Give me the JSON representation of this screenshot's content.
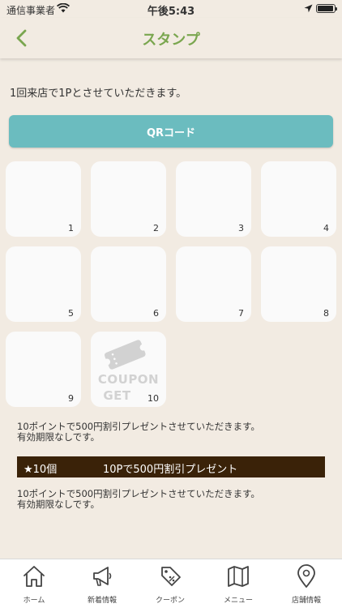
{
  "status_bar": {
    "carrier": "通信事業者",
    "time": "午後5:43"
  },
  "nav": {
    "title": "スタンプ"
  },
  "intro_text": "1回来店で1Pとさせていただきます。",
  "qr_button_label": "QRコード",
  "stamp_cells": [
    {
      "number": "1"
    },
    {
      "number": "2"
    },
    {
      "number": "3"
    },
    {
      "number": "4"
    },
    {
      "number": "5"
    },
    {
      "number": "6"
    },
    {
      "number": "7"
    },
    {
      "number": "8"
    },
    {
      "number": "9"
    },
    {
      "number": "10"
    }
  ],
  "coupon_label_1": "COUPON",
  "coupon_label_2": "GET",
  "description_1": {
    "line1": "10ポイントで500円割引プレゼントさせていただきます。",
    "line2": "有効期限なしです。"
  },
  "reward": {
    "count": "★10個",
    "text": "10Pで500円割引プレゼント"
  },
  "description_2": {
    "line1": "10ポイントで500円割引プレゼントさせていただきます。",
    "line2": "有効期限なしです。"
  },
  "tabs": [
    {
      "label": "ホーム",
      "icon": "home-icon"
    },
    {
      "label": "新着情報",
      "icon": "megaphone-icon"
    },
    {
      "label": "クーポン",
      "icon": "tag-icon"
    },
    {
      "label": "メニュー",
      "icon": "map-icon"
    },
    {
      "label": "店舗情報",
      "icon": "location-pin-icon"
    }
  ],
  "colors": {
    "accent_green": "#7aa64f",
    "qr_button": "#6bbcbf",
    "reward_bar": "#3a2208",
    "background": "#f2ebe2"
  }
}
